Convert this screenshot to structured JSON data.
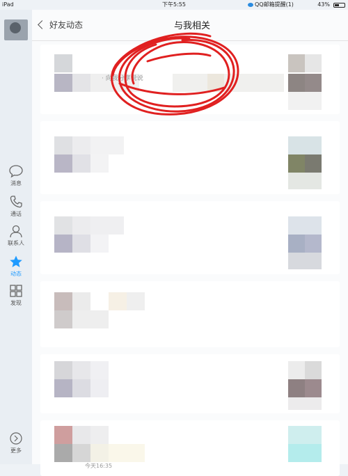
{
  "status_bar": {
    "device": "iPad",
    "time": "下午5:55",
    "notification": "QQ邮箱提醒(1)",
    "battery": "43%"
  },
  "sidebar": {
    "items": [
      {
        "label": "消息",
        "icon": "chat-bubble-icon"
      },
      {
        "label": "通话",
        "icon": "phone-icon"
      },
      {
        "label": "联系人",
        "icon": "contact-person-icon"
      },
      {
        "label": "动态",
        "icon": "star-icon",
        "active": true
      },
      {
        "label": "发现",
        "icon": "grid-icon"
      }
    ],
    "more_label": "更多"
  },
  "header": {
    "back_label": "好友动态",
    "title": "与我相关"
  },
  "feed": {
    "first_post_caption": "· 向我分享说说",
    "last_timestamp": "今天16:35"
  },
  "colors": {
    "accent": "#1f9bff",
    "annotation": "#e02020"
  }
}
